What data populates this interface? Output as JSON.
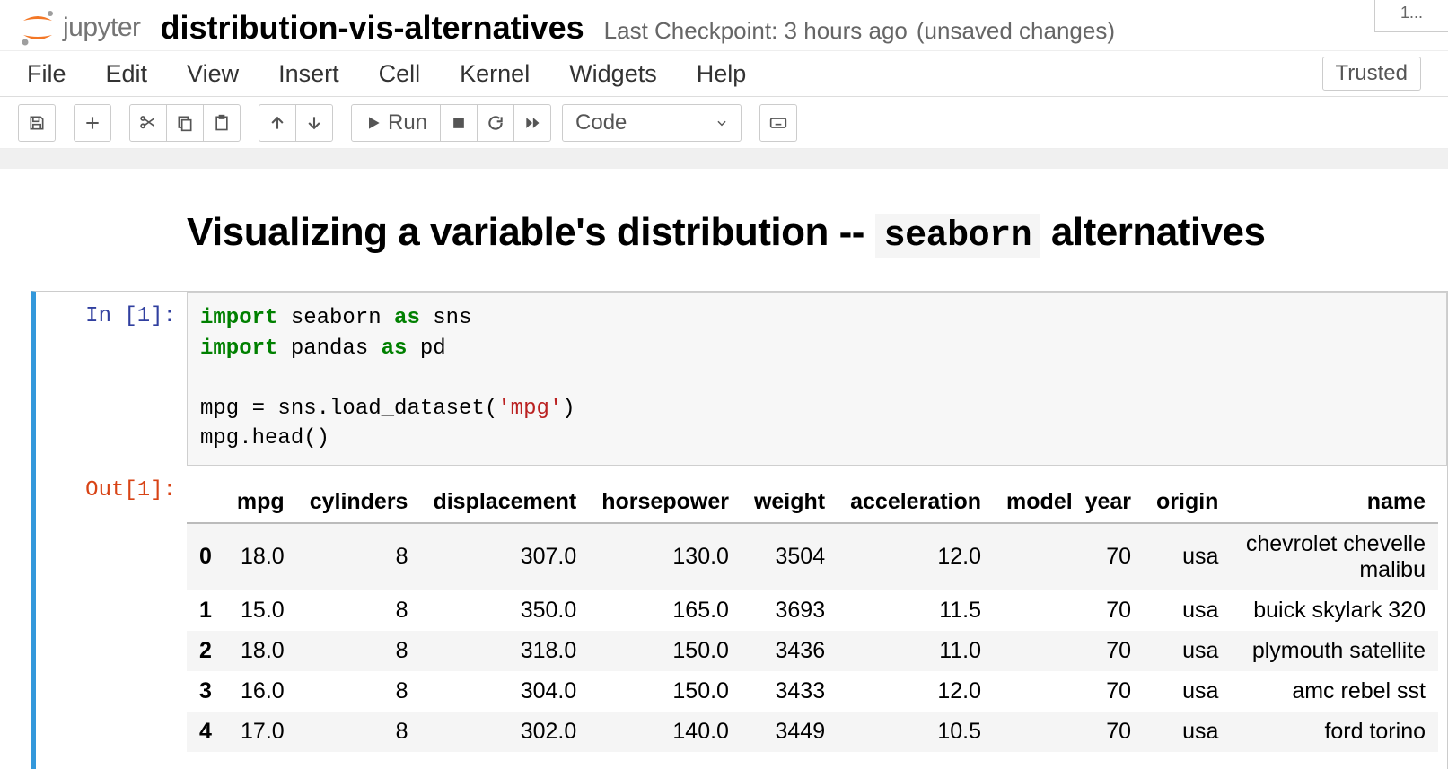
{
  "header": {
    "logo_word": "jupyter",
    "title": "distribution-vis-alternatives",
    "checkpoint": "Last Checkpoint: 3 hours ago",
    "unsaved": "(unsaved changes)",
    "tab_label": "1..."
  },
  "menubar": {
    "items": [
      "File",
      "Edit",
      "View",
      "Insert",
      "Cell",
      "Kernel",
      "Widgets",
      "Help"
    ],
    "trusted": "Trusted"
  },
  "toolbar": {
    "run_label": "Run",
    "celltype": "Code"
  },
  "markdown": {
    "title_pre": "Visualizing a variable's distribution -- ",
    "title_code": "seaborn",
    "title_post": " alternatives"
  },
  "cell1": {
    "in_prompt": "In [1]:",
    "out_prompt": "Out[1]:",
    "code": {
      "l1_kw1": "import",
      "l1_mid": " seaborn ",
      "l1_kw2": "as",
      "l1_end": " sns",
      "l2_kw1": "import",
      "l2_mid": " pandas ",
      "l2_kw2": "as",
      "l2_end": " pd",
      "l3": "",
      "l4_pre": "mpg = sns.load_dataset(",
      "l4_str": "'mpg'",
      "l4_post": ")",
      "l5": "mpg.head()"
    },
    "table": {
      "columns": [
        "mpg",
        "cylinders",
        "displacement",
        "horsepower",
        "weight",
        "acceleration",
        "model_year",
        "origin",
        "name"
      ],
      "rows": [
        {
          "idx": "0",
          "mpg": "18.0",
          "cylinders": "8",
          "displacement": "307.0",
          "horsepower": "130.0",
          "weight": "3504",
          "acceleration": "12.0",
          "model_year": "70",
          "origin": "usa",
          "name": "chevrolet chevelle malibu"
        },
        {
          "idx": "1",
          "mpg": "15.0",
          "cylinders": "8",
          "displacement": "350.0",
          "horsepower": "165.0",
          "weight": "3693",
          "acceleration": "11.5",
          "model_year": "70",
          "origin": "usa",
          "name": "buick skylark 320"
        },
        {
          "idx": "2",
          "mpg": "18.0",
          "cylinders": "8",
          "displacement": "318.0",
          "horsepower": "150.0",
          "weight": "3436",
          "acceleration": "11.0",
          "model_year": "70",
          "origin": "usa",
          "name": "plymouth satellite"
        },
        {
          "idx": "3",
          "mpg": "16.0",
          "cylinders": "8",
          "displacement": "304.0",
          "horsepower": "150.0",
          "weight": "3433",
          "acceleration": "12.0",
          "model_year": "70",
          "origin": "usa",
          "name": "amc rebel sst"
        },
        {
          "idx": "4",
          "mpg": "17.0",
          "cylinders": "8",
          "displacement": "302.0",
          "horsepower": "140.0",
          "weight": "3449",
          "acceleration": "10.5",
          "model_year": "70",
          "origin": "usa",
          "name": "ford torino"
        }
      ]
    }
  },
  "chart_data": {
    "type": "table",
    "columns": [
      "mpg",
      "cylinders",
      "displacement",
      "horsepower",
      "weight",
      "acceleration",
      "model_year",
      "origin",
      "name"
    ],
    "rows": [
      [
        18.0,
        8,
        307.0,
        130.0,
        3504,
        12.0,
        70,
        "usa",
        "chevrolet chevelle malibu"
      ],
      [
        15.0,
        8,
        350.0,
        165.0,
        3693,
        11.5,
        70,
        "usa",
        "buick skylark 320"
      ],
      [
        18.0,
        8,
        318.0,
        150.0,
        3436,
        11.0,
        70,
        "usa",
        "plymouth satellite"
      ],
      [
        16.0,
        8,
        304.0,
        150.0,
        3433,
        12.0,
        70,
        "usa",
        "amc rebel sst"
      ],
      [
        17.0,
        8,
        302.0,
        140.0,
        3449,
        10.5,
        70,
        "usa",
        "ford torino"
      ]
    ]
  }
}
